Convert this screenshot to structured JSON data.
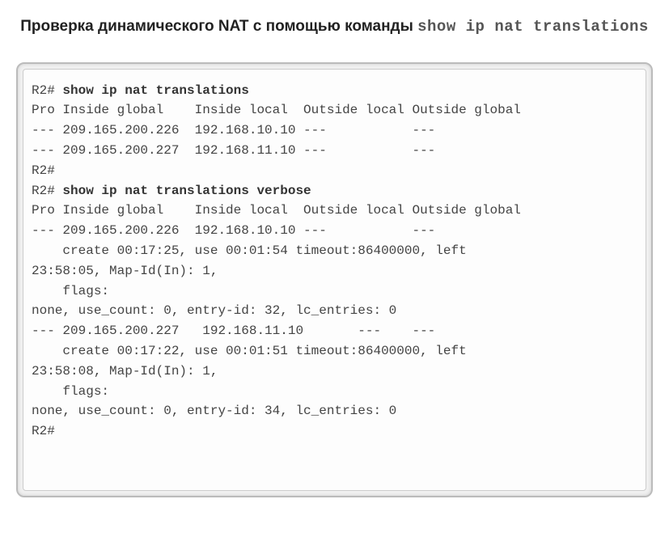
{
  "heading": {
    "prefix": "Проверка динамического NAT с помощью команды ",
    "command": "show ip nat translations"
  },
  "terminal": {
    "prompt1": "R2# ",
    "cmd1": "show ip nat translations",
    "header1": "Pro Inside global    Inside local  Outside local Outside global",
    "row1": "--- 209.165.200.226  192.168.10.10 ---           ---",
    "row2": "--- 209.165.200.227  192.168.11.10 ---           ---",
    "prompt2": "R2#",
    "prompt3": "R2# ",
    "cmd2": "show ip nat translations verbose",
    "header2": "Pro Inside global    Inside local  Outside local Outside global",
    "vrow1": "--- 209.165.200.226  192.168.10.10 ---           ---",
    "vline1": "    create 00:17:25, use 00:01:54 timeout:86400000, left",
    "vline2": "23:58:05, Map-Id(In): 1,",
    "vline3": "    flags:",
    "vline4": "none, use_count: 0, entry-id: 32, lc_entries: 0",
    "vrow2": "--- 209.165.200.227   192.168.11.10       ---    ---",
    "vline5": "    create 00:17:22, use 00:01:51 timeout:86400000, left",
    "vline6": "23:58:08, Map-Id(In): 1,",
    "vline7": "    flags:",
    "vline8": "none, use_count: 0, entry-id: 34, lc_entries: 0",
    "prompt4": "R2#"
  }
}
